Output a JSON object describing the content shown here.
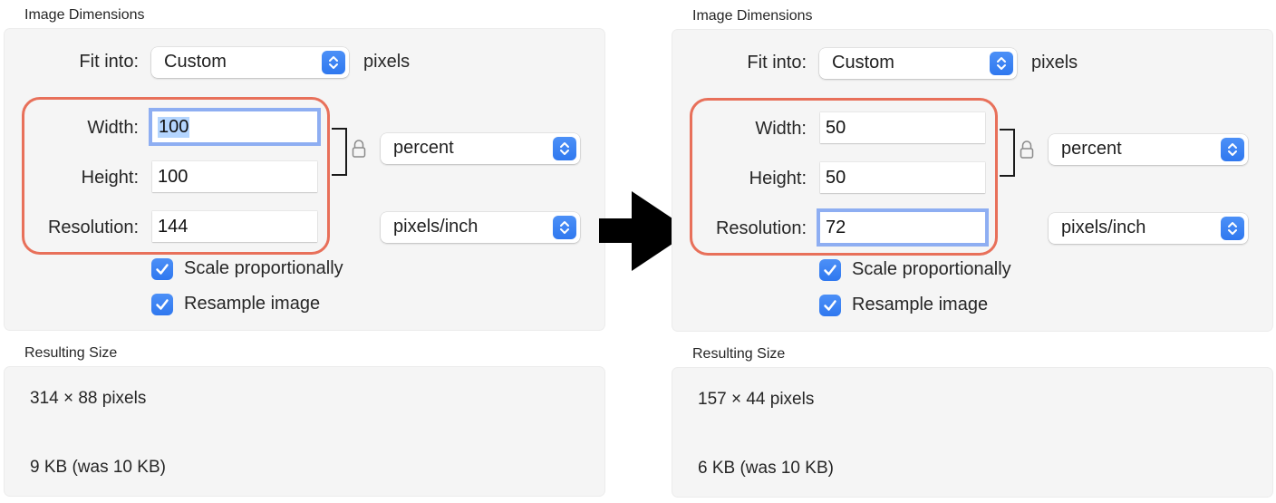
{
  "panels": [
    {
      "id": "before",
      "dimensions_label": "Image Dimensions",
      "fit_into": {
        "label": "Fit into:",
        "value": "Custom",
        "suffix": "pixels"
      },
      "width": {
        "label": "Width:",
        "value": "100",
        "focused": true,
        "selected": true
      },
      "height": {
        "label": "Height:",
        "value": "100",
        "focused": false
      },
      "resolution": {
        "label": "Resolution:",
        "value": "144",
        "focused": false
      },
      "size_unit": "percent",
      "resolution_unit": "pixels/inch",
      "scale_proportionally": {
        "label": "Scale proportionally",
        "checked": true
      },
      "resample_image": {
        "label": "Resample image",
        "checked": true
      },
      "result_label": "Resulting Size",
      "result_pixels": "314 × 88 pixels",
      "result_filesize": "9 KB (was 10 KB)"
    },
    {
      "id": "after",
      "dimensions_label": "Image Dimensions",
      "fit_into": {
        "label": "Fit into:",
        "value": "Custom",
        "suffix": "pixels"
      },
      "width": {
        "label": "Width:",
        "value": "50",
        "focused": false
      },
      "height": {
        "label": "Height:",
        "value": "50",
        "focused": false
      },
      "resolution": {
        "label": "Resolution:",
        "value": "72",
        "focused": true
      },
      "size_unit": "percent",
      "resolution_unit": "pixels/inch",
      "scale_proportionally": {
        "label": "Scale proportionally",
        "checked": true
      },
      "resample_image": {
        "label": "Resample image",
        "checked": true
      },
      "result_label": "Resulting Size",
      "result_pixels": "157 × 44 pixels",
      "result_filesize": "6 KB (was 10 KB)"
    }
  ],
  "annotations": {
    "highlight_color": "#e8705a",
    "arrow": "right-arrow",
    "accent_color": "#3a84f5",
    "focus_ring_color": "#8eaef2"
  },
  "icons": {
    "stepper": "chevron-up-down-icon",
    "lock": "lock-icon",
    "check": "checkmark-icon"
  }
}
